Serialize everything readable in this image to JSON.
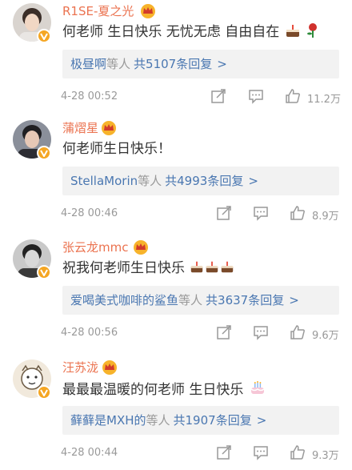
{
  "comments": [
    {
      "username": "R1SE-夏之光",
      "text": "何老师 生日快乐 无忧无虑 自由自在",
      "reply_user": "极昼啊",
      "reply_mid": "等人",
      "reply_count": "共5107条回复",
      "chevron": ">",
      "time": "4-28 00:52",
      "likes": "11.2万",
      "emojis": [
        "cake-icon",
        "rose-icon"
      ]
    },
    {
      "username": "蒲熠星",
      "text": "何老师生日快乐！",
      "reply_user": "StellaMorin",
      "reply_mid": "等人",
      "reply_count": "共4993条回复",
      "chevron": ">",
      "time": "4-28 00:46",
      "likes": "8.9万",
      "emojis": []
    },
    {
      "username": "张云龙mmc",
      "text": "祝我何老师生日快乐",
      "reply_user": "爱喝美式咖啡的鲨鱼",
      "reply_mid": "等人",
      "reply_count": "共3637条回复",
      "chevron": ">",
      "time": "4-28 00:56",
      "likes": "9.6万",
      "emojis": [
        "cake-icon",
        "cake-icon",
        "cake-icon"
      ]
    },
    {
      "username": "汪苏泷",
      "text": "最最最温暖的何老师 生日快乐",
      "reply_user": "藓藓是MXH的",
      "reply_mid": "等人",
      "reply_count": "共1907条回复",
      "chevron": ">",
      "time": "4-28 00:44",
      "likes": "9.3万",
      "emojis": [
        "birthday-cake-icon"
      ]
    }
  ],
  "colors": {
    "username": "#eb7350",
    "link": "#4a77b1",
    "muted": "#999999",
    "text": "#333333",
    "badge": "#f5a623"
  }
}
